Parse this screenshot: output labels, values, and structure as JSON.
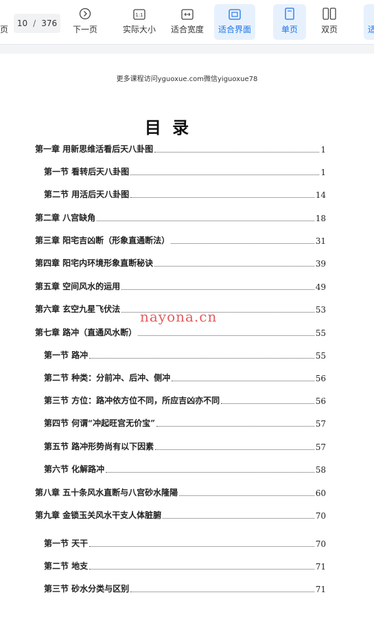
{
  "toolbar": {
    "prev_label_cut": "页",
    "page_current": "10",
    "page_sep": "/",
    "page_total": "376",
    "next_label": "下一页",
    "actual_size_label": "实际大小",
    "actual_size_icon_text": "1:1",
    "fit_width_label": "适合宽度",
    "fit_screen_label": "适合界面",
    "single_page_label": "单页",
    "double_page_label": "双页",
    "cut_right_label": "适",
    "accent_color": "#1a73e8"
  },
  "document": {
    "watermark_top": "更多课程访问yguoxue.com微信yiguoxue78",
    "title": "目  录",
    "site_mark": "nayona.cn",
    "toc": [
      {
        "label": "第一章  用新思维活看后天八卦图",
        "page": "1",
        "level": 1
      },
      {
        "label": "第一节  看转后天八卦图",
        "page": "1",
        "level": 2
      },
      {
        "label": "第二节  用活后天八卦图",
        "page": "14",
        "level": 2
      },
      {
        "label": "第二章  八宫缺角",
        "page": "18",
        "level": 1
      },
      {
        "label": "第三章  阳宅吉凶断（形象直通断法）",
        "page": "31",
        "level": 1
      },
      {
        "label": "第四章  阳宅内环境形象直断秘诀",
        "page": "39",
        "level": 1
      },
      {
        "label": "第五章  空间风水的运用",
        "page": "49",
        "level": 1
      },
      {
        "label": "第六章  玄空九星飞伏法",
        "page": "53",
        "level": 1
      },
      {
        "label": "第七章  路冲（直通风水断）",
        "page": "55",
        "level": 1
      },
      {
        "label": "第一节  路冲",
        "page": "55",
        "level": 2
      },
      {
        "label": "第二节  种类：分前冲、后冲、侧冲",
        "page": "56",
        "level": 2
      },
      {
        "label": "第三节  方位：路冲依方位不同，所应吉凶亦不同",
        "page": "56",
        "level": 2
      },
      {
        "label": "第四节  何谓“冲起旺宫无价宝”",
        "page": "57",
        "level": 2
      },
      {
        "label": "第五节  路冲形势尚有以下因素",
        "page": "57",
        "level": 2
      },
      {
        "label": "第六节  化解路冲",
        "page": "58",
        "level": 2
      },
      {
        "label": "第八章  五十条风水直断与八宫砂水隆陽",
        "page": "60",
        "level": 1
      },
      {
        "label": "第九章  金锁玉关风水干支人体脏腑",
        "page": "70",
        "level": 1
      },
      {
        "label": "第一节  天干",
        "page": "70",
        "level": 2
      },
      {
        "label": "第二节  地支",
        "page": "71",
        "level": 2
      },
      {
        "label": "第三节  砂水分类与区别",
        "page": "71",
        "level": 2
      }
    ]
  }
}
